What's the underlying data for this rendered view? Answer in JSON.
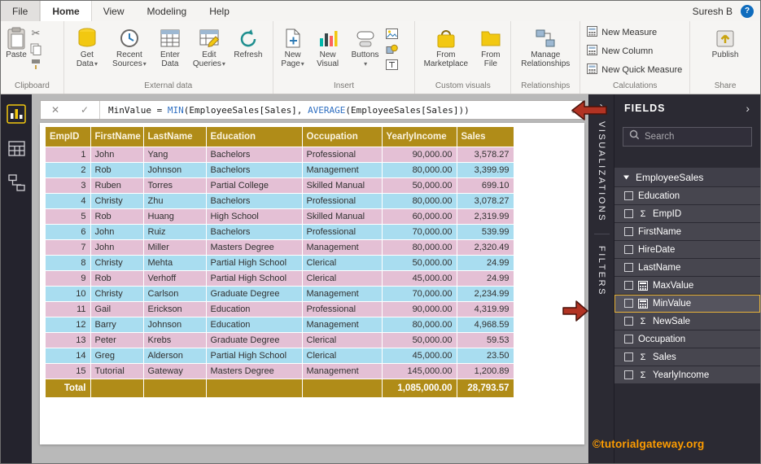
{
  "titlebar": {
    "tabs": [
      "File",
      "Home",
      "View",
      "Modeling",
      "Help"
    ],
    "active_tab": "Home",
    "user": "Suresh B",
    "help": "?"
  },
  "ribbon": {
    "clipboard": {
      "label": "Clipboard",
      "paste": "Paste"
    },
    "external": {
      "label": "External data",
      "get1": "Get",
      "get2": "Data",
      "recent1": "Recent",
      "recent2": "Sources",
      "enter1": "Enter",
      "enter2": "Data",
      "edit1": "Edit",
      "edit2": "Queries",
      "refresh": "Refresh"
    },
    "insert": {
      "label": "Insert",
      "page1": "New",
      "page2": "Page",
      "visual1": "New",
      "visual2": "Visual",
      "buttons": "Buttons"
    },
    "custom": {
      "label": "Custom visuals",
      "mk1": "From",
      "mk2": "Marketplace",
      "file1": "From",
      "file2": "File"
    },
    "relationships": {
      "label": "Relationships",
      "manage1": "Manage",
      "manage2": "Relationships"
    },
    "calculations": {
      "label": "Calculations",
      "items": [
        "New Measure",
        "New Column",
        "New Quick Measure"
      ]
    },
    "share": {
      "label": "Share",
      "publish": "Publish"
    }
  },
  "formula_bar": {
    "pre": "MinValue = ",
    "fn1": "MIN",
    "mid": "(EmployeeSales[Sales], ",
    "fn2": "AVERAGE",
    "end": "(EmployeeSales[Sales]))"
  },
  "glyphs": {
    "caret": "▾",
    "chevron": "›",
    "close": "✕",
    "check": "✓",
    "dropdown": "⌄",
    "sigma": "Σ"
  },
  "panels": {
    "visualizations": "VISUALIZATIONS",
    "filters": "FILTERS",
    "fields_title": "FIELDS",
    "search_placeholder": "Search",
    "table_name": "EmployeeSales",
    "fields": [
      {
        "label": "Education",
        "icon": "none"
      },
      {
        "label": "EmpID",
        "icon": "sigma"
      },
      {
        "label": "FirstName",
        "icon": "none"
      },
      {
        "label": "HireDate",
        "icon": "none"
      },
      {
        "label": "LastName",
        "icon": "none"
      },
      {
        "label": "MaxValue",
        "icon": "calc"
      },
      {
        "label": "MinValue",
        "icon": "calc",
        "highlighted": true
      },
      {
        "label": "NewSale",
        "icon": "sigma"
      },
      {
        "label": "Occupation",
        "icon": "none"
      },
      {
        "label": "Sales",
        "icon": "sigma"
      },
      {
        "label": "YearlyIncome",
        "icon": "sigma"
      }
    ]
  },
  "table": {
    "columns": [
      "EmpID",
      "FirstName",
      "LastName",
      "Education",
      "Occupation",
      "YearlyIncome",
      "Sales"
    ],
    "rows": [
      [
        "1",
        "John",
        "Yang",
        "Bachelors",
        "Professional",
        "90,000.00",
        "3,578.27"
      ],
      [
        "2",
        "Rob",
        "Johnson",
        "Bachelors",
        "Management",
        "80,000.00",
        "3,399.99"
      ],
      [
        "3",
        "Ruben",
        "Torres",
        "Partial College",
        "Skilled Manual",
        "50,000.00",
        "699.10"
      ],
      [
        "4",
        "Christy",
        "Zhu",
        "Bachelors",
        "Professional",
        "80,000.00",
        "3,078.27"
      ],
      [
        "5",
        "Rob",
        "Huang",
        "High School",
        "Skilled Manual",
        "60,000.00",
        "2,319.99"
      ],
      [
        "6",
        "John",
        "Ruiz",
        "Bachelors",
        "Professional",
        "70,000.00",
        "539.99"
      ],
      [
        "7",
        "John",
        "Miller",
        "Masters Degree",
        "Management",
        "80,000.00",
        "2,320.49"
      ],
      [
        "8",
        "Christy",
        "Mehta",
        "Partial High School",
        "Clerical",
        "50,000.00",
        "24.99"
      ],
      [
        "9",
        "Rob",
        "Verhoff",
        "Partial High School",
        "Clerical",
        "45,000.00",
        "24.99"
      ],
      [
        "10",
        "Christy",
        "Carlson",
        "Graduate Degree",
        "Management",
        "70,000.00",
        "2,234.99"
      ],
      [
        "11",
        "Gail",
        "Erickson",
        "Education",
        "Professional",
        "90,000.00",
        "4,319.99"
      ],
      [
        "12",
        "Barry",
        "Johnson",
        "Education",
        "Management",
        "80,000.00",
        "4,968.59"
      ],
      [
        "13",
        "Peter",
        "Krebs",
        "Graduate Degree",
        "Clerical",
        "50,000.00",
        "59.53"
      ],
      [
        "14",
        "Greg",
        "Alderson",
        "Partial High School",
        "Clerical",
        "45,000.00",
        "23.50"
      ],
      [
        "15",
        "Tutorial",
        "Gateway",
        "Masters Degree",
        "Management",
        "145,000.00",
        "1,200.89"
      ]
    ],
    "total": {
      "label": "Total",
      "yearly": "1,085,000.00",
      "sales": "28,793.57"
    }
  },
  "watermark": "©tutorialgateway.org",
  "colors": {
    "table_header": "#b08c18",
    "row_pink": "#e4c0d5",
    "row_blue": "#a9ddf0",
    "highlight_gold": "#e8b33a",
    "arrow_red": "#b23323",
    "brand_yellow": "#f2c811",
    "watermark_orange": "#ff9d00"
  }
}
